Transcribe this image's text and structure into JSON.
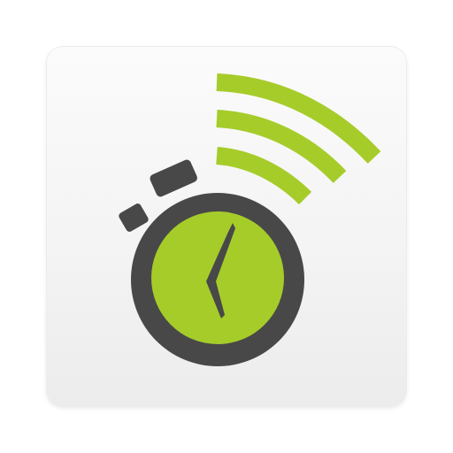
{
  "app": {
    "icon_names": [
      "stopwatch-icon",
      "wireless-signal-icon"
    ]
  },
  "colors": {
    "accent": "#a6cc2a",
    "dark": "#484848",
    "tile": "#f5f5f5",
    "tile_border": "#e8e8e8"
  }
}
